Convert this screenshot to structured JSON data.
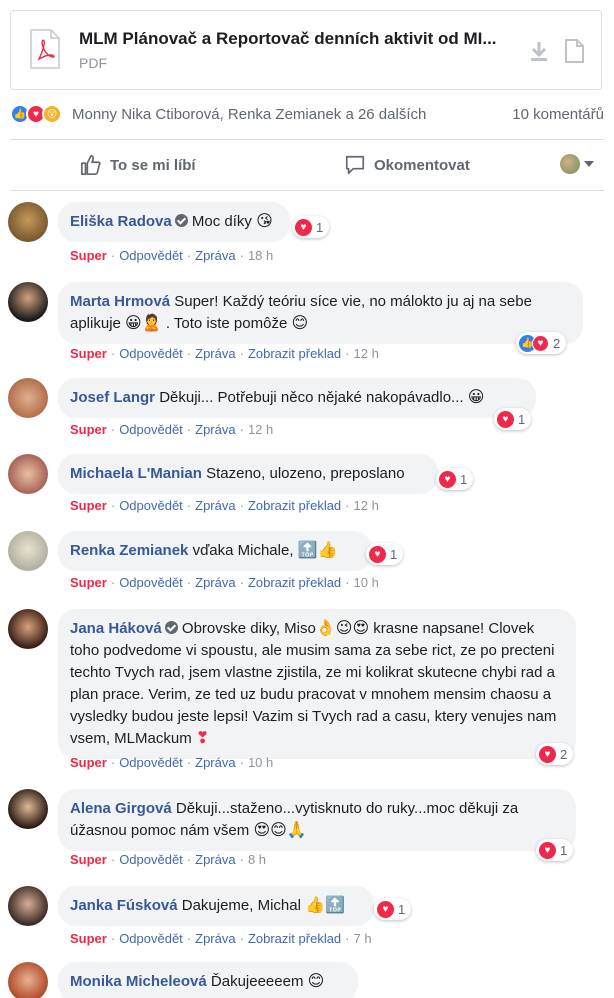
{
  "attachment": {
    "title": "MLM Plánovač a Reportovač denních aktivit od MI...",
    "type": "PDF"
  },
  "summary": {
    "names": "Monny Nika Ctiborová, Renka Zemianek a 26 dalších",
    "comments": "10 komentářů"
  },
  "actions": {
    "like": "To se mi líbí",
    "comment": "Okomentovat"
  },
  "comments": [
    {
      "author": "Eliška Radova",
      "text": "Moc díky",
      "emoji": "😘",
      "verified": true,
      "reaction_count": "1",
      "super": "Super",
      "reply": "Odpovědět",
      "message": "Zpráva",
      "translate": "",
      "time": "18 h"
    },
    {
      "author": "Marta Hrmová",
      "text": "Super! Každý teóriu síce vie, no málokto ju aj na sebe aplikuje",
      "emoji": "😀🙎",
      "text2": ". Toto iste pomôže",
      "emoji2": "😊",
      "reaction_count": "2",
      "super": "Super",
      "reply": "Odpovědět",
      "message": "Zpráva",
      "translate": "Zobrazit překlad",
      "time": "12 h"
    },
    {
      "author": "Josef Langr",
      "text": "Děkuji... Potřebuji něco nějaké nakopávadlo...",
      "emoji": "😀",
      "reaction_count": "1",
      "super": "Super",
      "reply": "Odpovědět",
      "message": "Zpráva",
      "translate": "",
      "time": "12 h"
    },
    {
      "author": "Michaela L'Manian",
      "text": "Stazeno, ulozeno, preposlano",
      "reaction_count": "1",
      "super": "Super",
      "reply": "Odpovědět",
      "message": "Zpráva",
      "translate": "Zobrazit překlad",
      "time": "12 h"
    },
    {
      "author": "Renka Zemianek",
      "text": "vďaka Michale,",
      "emoji": "🔝👍",
      "reaction_count": "1",
      "super": "Super",
      "reply": "Odpovědět",
      "message": "Zpráva",
      "translate": "Zobrazit překlad",
      "time": "10 h"
    },
    {
      "author": "Jana Háková",
      "verified": true,
      "text": "Obrovske diky, Miso",
      "emoji": "👌😉😍",
      "text2": "krasne napsane! Clovek toho podvedome vi spoustu, ale musim sama za sebe rict, ze po precteni techto Tvych rad, jsem vlastne zjistila, ze mi kolikrat skutecne chybi rad a plan prace. Verim, ze ted uz budu pracovat v mnohem mensim chaosu a vysledky budou jeste lepsi! Vazim si Tvych rad a casu, ktery venujes nam vsem, MLMackum",
      "emoji2": "❣",
      "reaction_count": "2",
      "super": "Super",
      "reply": "Odpovědět",
      "message": "Zpráva",
      "translate": "",
      "time": "10 h"
    },
    {
      "author": "Alena Girgová",
      "text": "Děkuji...staženo...vytisknuto do ruky...moc děkuji za úžasnou pomoc nám všem",
      "emoji": "😍😊🙏",
      "reaction_count": "1",
      "super": "Super",
      "reply": "Odpovědět",
      "message": "Zpráva",
      "translate": "",
      "time": "8 h"
    },
    {
      "author": "Janka Fúsková",
      "text": "Dakujeme, Michal",
      "emoji": "👍🔝",
      "reaction_count": "1",
      "super": "Super",
      "reply": "Odpovědět",
      "message": "Zpráva",
      "translate": "Zobrazit překlad",
      "time": "7 h"
    },
    {
      "author": "Monika Micheleová",
      "text": "Ďakujeeeeem",
      "emoji": "😊"
    }
  ],
  "colors": {
    "author": "#385898",
    "super": "#f0284a",
    "link": "#4267b2",
    "bubble": "#f2f3f5"
  }
}
